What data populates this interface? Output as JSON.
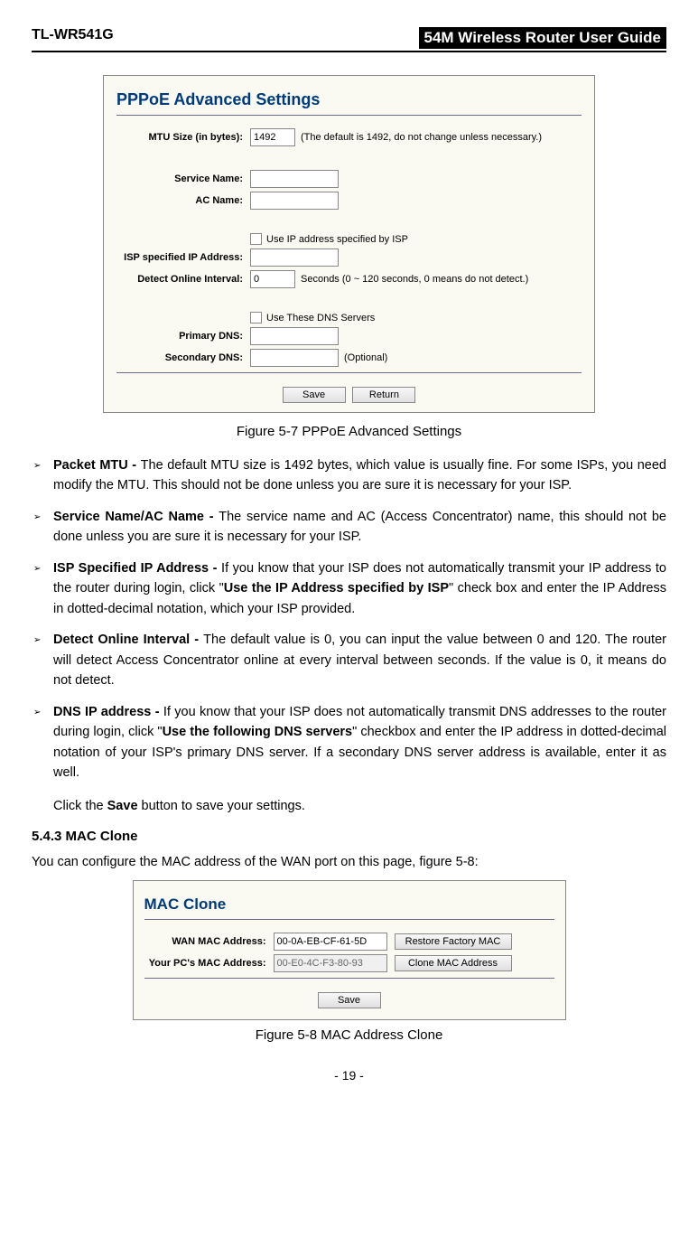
{
  "header": {
    "left": "TL-WR541G",
    "right": "54M Wireless Router User Guide"
  },
  "panel1": {
    "title": "PPPoE Advanced Settings",
    "mtu_label": "MTU Size (in bytes):",
    "mtu_value": "1492",
    "mtu_note": "(The default is 1492, do not change unless necessary.)",
    "service_name_label": "Service Name:",
    "ac_name_label": "AC Name:",
    "use_ip_label": "Use IP address specified by ISP",
    "isp_ip_label": "ISP specified IP Address:",
    "detect_label": "Detect Online Interval:",
    "detect_value": "0",
    "detect_note": "Seconds (0 ~ 120 seconds, 0 means do not detect.)",
    "use_dns_label": "Use These DNS Servers",
    "primary_dns_label": "Primary DNS:",
    "secondary_dns_label": "Secondary DNS:",
    "secondary_note": "(Optional)",
    "save_btn": "Save",
    "return_btn": "Return"
  },
  "caption1": "Figure 5-7     PPPoE Advanced Settings",
  "bullets": {
    "b1_bold": "Packet MTU - ",
    "b1_text": "The default MTU size is 1492 bytes, which value is usually fine. For some ISPs, you need modify the MTU. This should not be done unless you are sure it is necessary for your ISP.",
    "b2_bold": "Service Name/AC Name - ",
    "b2_text": "The service name and AC (Access Concentrator) name, this should not be done unless you are sure it is necessary for your ISP.",
    "b3_bold": "ISP Specified IP Address - ",
    "b3_text1": "If you know that your ISP does not automatically transmit your IP address to the router during login, click \"",
    "b3_bold2": "Use the IP Address specified by ISP",
    "b3_text2": "\" check box and enter the IP Address in dotted-decimal notation, which your ISP provided.",
    "b4_bold": "Detect Online Interval - ",
    "b4_text": "The default value is 0, you can input the value between 0 and 120. The router will detect Access Concentrator online at every interval between seconds. If the value is 0, it means do not detect.",
    "b5_bold": "DNS IP address - ",
    "b5_text1": "If you know that your ISP does not automatically transmit DNS addresses to the router during login, click \"",
    "b5_bold2": "Use the following DNS servers",
    "b5_text2": "\" checkbox and enter the IP address in dotted-decimal notation of your ISP's primary DNS server. If a secondary DNS server address is available, enter it as well."
  },
  "save_para1": "Click the ",
  "save_bold": "Save",
  "save_para2": " button to save your settings.",
  "section_head": "5.4.3 MAC Clone",
  "mac_intro": "You can configure the MAC address of the WAN port on this page, figure 5-8:",
  "panel2": {
    "title": "MAC Clone",
    "wan_label": "WAN MAC Address:",
    "wan_value": "00-0A-EB-CF-61-5D",
    "restore_btn": "Restore Factory MAC",
    "pc_label": "Your PC's MAC Address:",
    "pc_value": "00-E0-4C-F3-80-93",
    "clone_btn": "Clone MAC Address",
    "save_btn": "Save"
  },
  "caption2": "Figure 5-8    MAC Address Clone",
  "page_num": "- 19 -"
}
